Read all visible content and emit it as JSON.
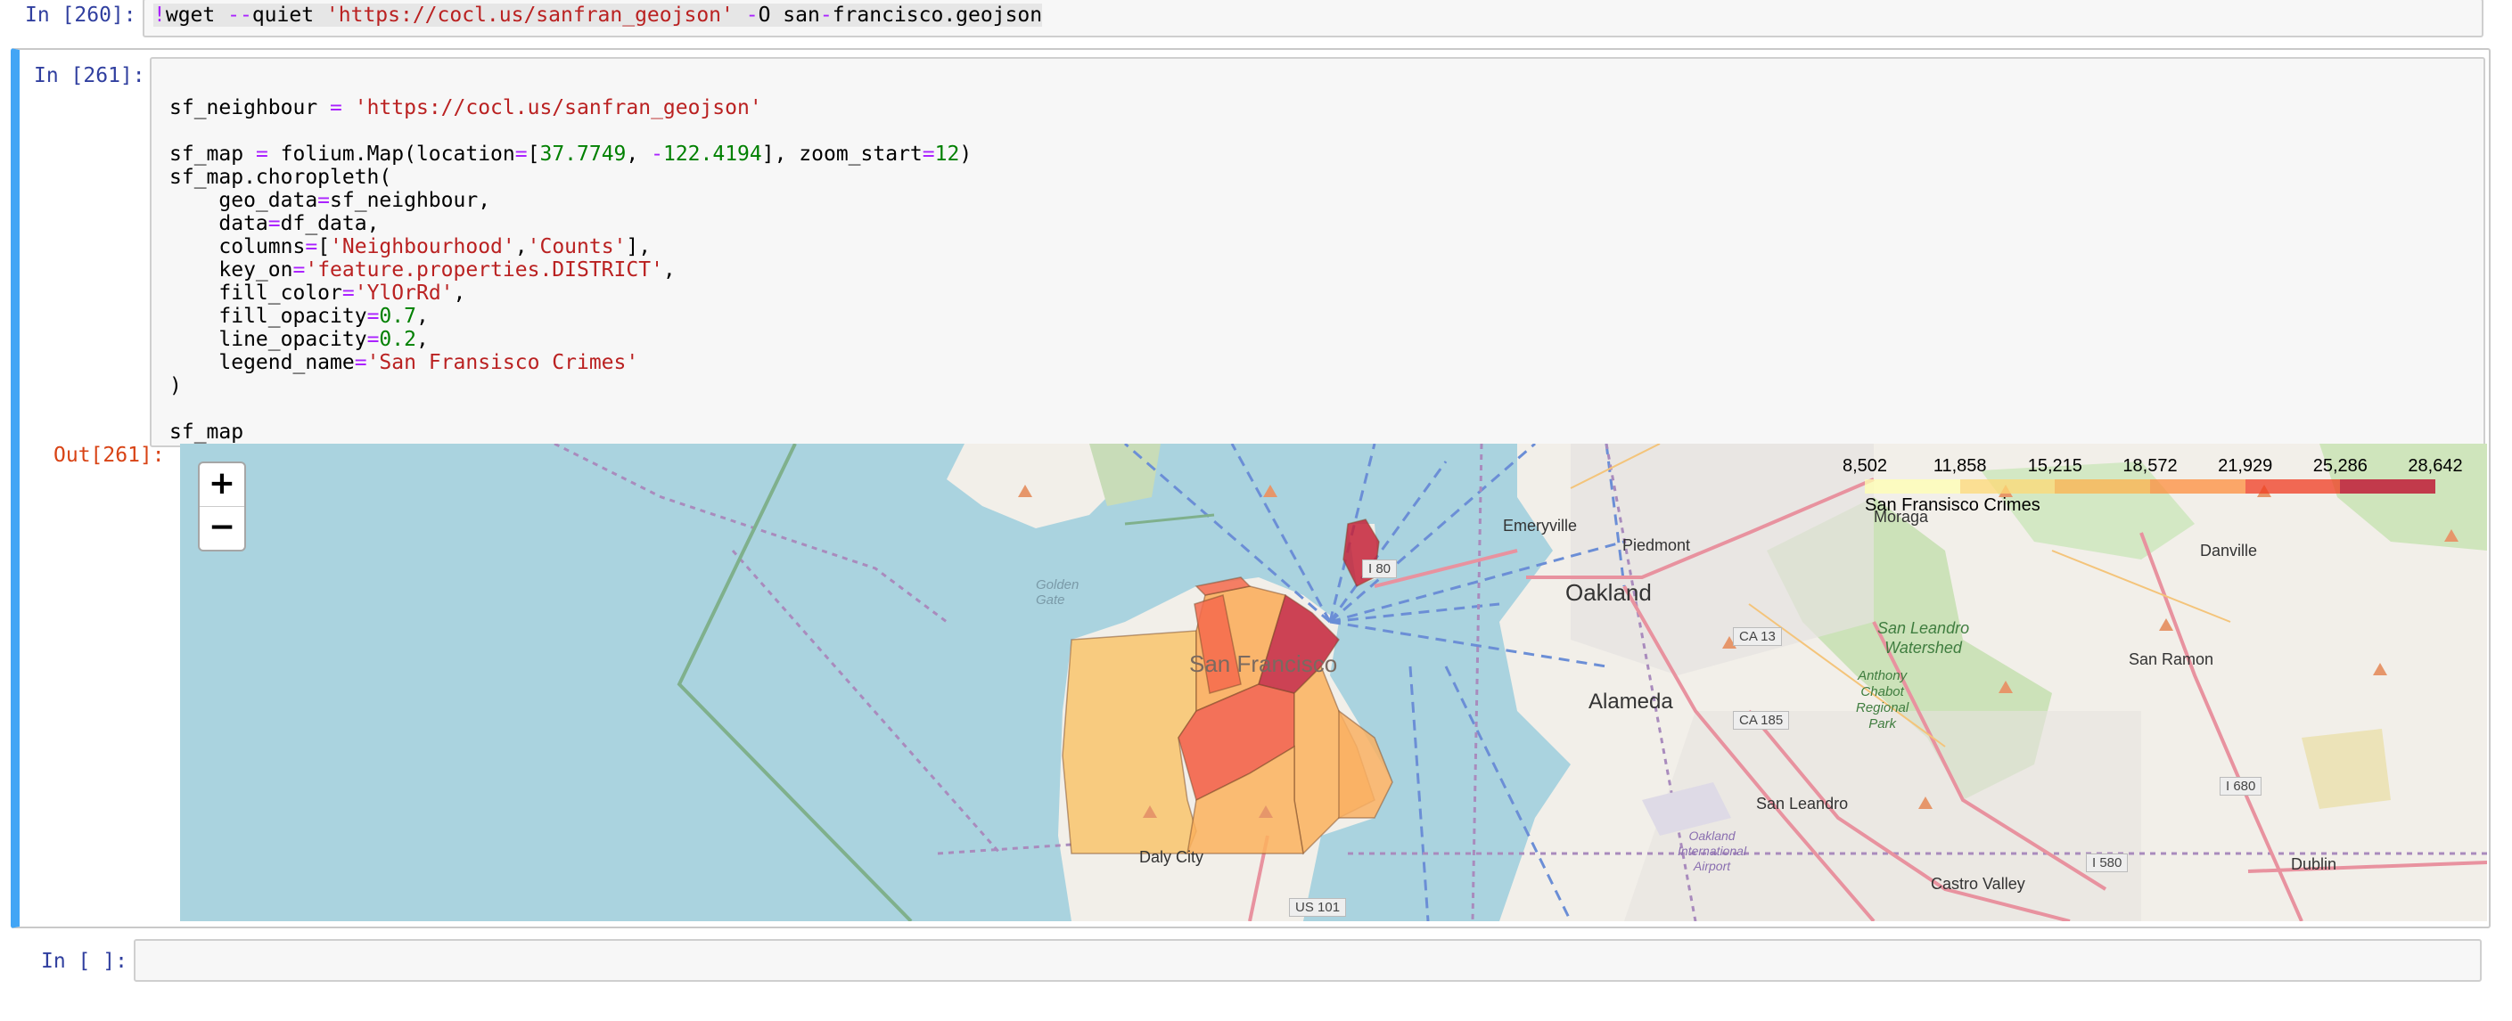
{
  "cells": {
    "c260": {
      "prompt": "In [260]:",
      "code_bang": "!",
      "code_cmd": "wget ",
      "code_flag1": "--",
      "code_flag1b": "quiet ",
      "code_url": "'https://cocl.us/sanfran_geojson'",
      "code_sp": " ",
      "code_flag2": "-",
      "code_flag2b": "O san",
      "code_dash": "-",
      "code_rest": "francisco.geojson"
    },
    "c261": {
      "prompt": "In [261]:",
      "out_prompt": "Out[261]:",
      "lines": [
        [
          {
            "t": "sf_neighbour ",
            "c": ""
          },
          {
            "t": "=",
            "c": "o"
          },
          {
            "t": " ",
            "c": ""
          },
          {
            "t": "'https://cocl.us/sanfran_geojson'",
            "c": "s"
          }
        ],
        [],
        [
          {
            "t": "sf_map ",
            "c": ""
          },
          {
            "t": "=",
            "c": "o"
          },
          {
            "t": " folium.Map(location",
            "c": ""
          },
          {
            "t": "=",
            "c": "o"
          },
          {
            "t": "[",
            "c": ""
          },
          {
            "t": "37.7749",
            "c": "n"
          },
          {
            "t": ", ",
            "c": ""
          },
          {
            "t": "-",
            "c": "o"
          },
          {
            "t": "122.4194",
            "c": "n"
          },
          {
            "t": "], zoom_start",
            "c": ""
          },
          {
            "t": "=",
            "c": "o"
          },
          {
            "t": "12",
            "c": "n"
          },
          {
            "t": ")",
            "c": ""
          }
        ],
        [
          {
            "t": "sf_map.choropleth(",
            "c": ""
          }
        ],
        [
          {
            "t": "    geo_data",
            "c": ""
          },
          {
            "t": "=",
            "c": "o"
          },
          {
            "t": "sf_neighbour,",
            "c": ""
          }
        ],
        [
          {
            "t": "    data",
            "c": ""
          },
          {
            "t": "=",
            "c": "o"
          },
          {
            "t": "df_data,",
            "c": ""
          }
        ],
        [
          {
            "t": "    columns",
            "c": ""
          },
          {
            "t": "=",
            "c": "o"
          },
          {
            "t": "[",
            "c": ""
          },
          {
            "t": "'Neighbourhood'",
            "c": "s"
          },
          {
            "t": ",",
            "c": ""
          },
          {
            "t": "'Counts'",
            "c": "s"
          },
          {
            "t": "],",
            "c": ""
          }
        ],
        [
          {
            "t": "    key_on",
            "c": ""
          },
          {
            "t": "=",
            "c": "o"
          },
          {
            "t": "'feature.properties.DISTRICT'",
            "c": "s"
          },
          {
            "t": ",",
            "c": ""
          }
        ],
        [
          {
            "t": "    fill_color",
            "c": ""
          },
          {
            "t": "=",
            "c": "o"
          },
          {
            "t": "'YlOrRd'",
            "c": "s"
          },
          {
            "t": ",",
            "c": ""
          }
        ],
        [
          {
            "t": "    fill_opacity",
            "c": ""
          },
          {
            "t": "=",
            "c": "o"
          },
          {
            "t": "0.7",
            "c": "n"
          },
          {
            "t": ",",
            "c": ""
          }
        ],
        [
          {
            "t": "    line_opacity",
            "c": ""
          },
          {
            "t": "=",
            "c": "o"
          },
          {
            "t": "0.2",
            "c": "n"
          },
          {
            "t": ",",
            "c": ""
          }
        ],
        [
          {
            "t": "    legend_name",
            "c": ""
          },
          {
            "t": "=",
            "c": "o"
          },
          {
            "t": "'San Fransisco Crimes'",
            "c": "s"
          }
        ],
        [
          {
            "t": ")",
            "c": ""
          }
        ],
        [],
        [
          {
            "t": "sf_map",
            "c": ""
          }
        ]
      ]
    },
    "cEmpty": {
      "prompt": "In [ ]:"
    }
  },
  "map": {
    "zoom_in": "+",
    "zoom_out": "−",
    "legend": {
      "ticks": [
        "8,502",
        "11,858",
        "15,215",
        "18,572",
        "21,929",
        "25,286",
        "28,642"
      ],
      "caption": "San Fransisco Crimes",
      "colors": [
        "#ffffb2",
        "#fed976",
        "#feb24c",
        "#fd8d3c",
        "#f03b20",
        "#bd0026"
      ]
    },
    "labels": {
      "golden_gate": "Golden\nGate",
      "san_francisco": "San Francisco",
      "oakland": "Oakland",
      "alameda": "Alameda",
      "emeryville": "Emeryville",
      "piedmont": "Piedmont",
      "moraga": "Moraga",
      "danville": "Danville",
      "san_ramon": "San Ramon",
      "san_leandro": "San Leandro",
      "watershed": "San Leandro\nWatershed",
      "anthony": "Anthony\nChabot\nRegional\nPark",
      "castro_valley": "Castro Valley",
      "dublin": "Dublin",
      "daly_city": "Daly City",
      "oakland_airport": "Oakland\nInternational\nAirport",
      "us101": "US 101",
      "ca13": "CA 13",
      "ca185": "CA 185",
      "i580": "I 580",
      "i680": "I 680",
      "i80": "I 80"
    }
  }
}
